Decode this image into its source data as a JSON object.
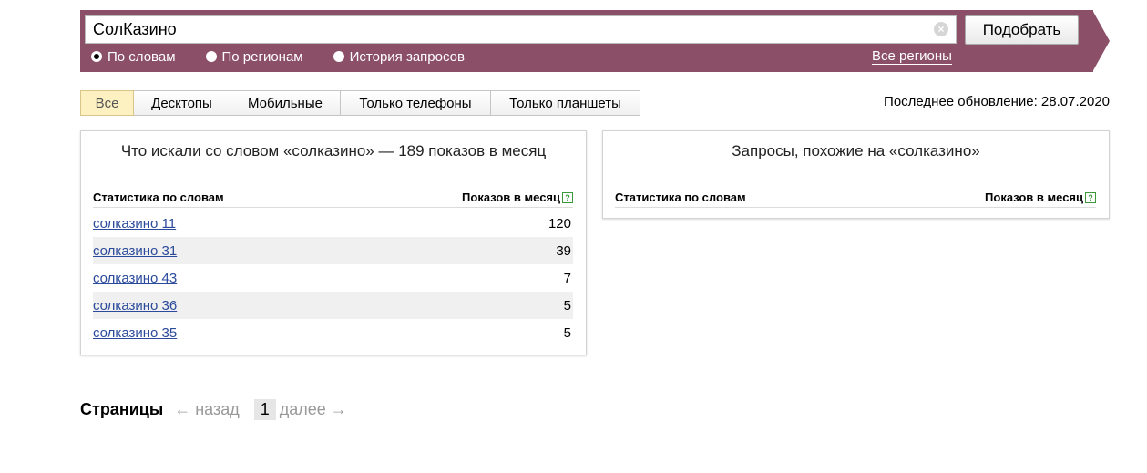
{
  "search": {
    "value": "СолКазино",
    "clear_glyph": "×",
    "submit_label": "Подобрать"
  },
  "modes": [
    {
      "label": "По словам",
      "checked": true
    },
    {
      "label": "По регионам",
      "checked": false
    },
    {
      "label": "История запросов",
      "checked": false
    }
  ],
  "regions_link": "Все регионы",
  "tabs": [
    "Все",
    "Десктопы",
    "Мобильные",
    "Только телефоны",
    "Только планшеты"
  ],
  "active_tab": "Все",
  "updated": "Последнее обновление: 28.07.2020",
  "left_card": {
    "title": "Что искали со словом «солказино» — 189 показов в месяц",
    "col_words": "Статистика по словам",
    "col_shows": "Показов в месяц",
    "help_glyph": "?",
    "rows": [
      {
        "phrase": "солказино 11",
        "shows": "120"
      },
      {
        "phrase": "солказино 31",
        "shows": "39"
      },
      {
        "phrase": "солказино 43",
        "shows": "7"
      },
      {
        "phrase": "солказино 36",
        "shows": "5"
      },
      {
        "phrase": "солказино 35",
        "shows": "5"
      }
    ]
  },
  "right_card": {
    "title": "Запросы, похожие на «солказино»",
    "col_words": "Статистика по словам",
    "col_shows": "Показов в месяц",
    "help_glyph": "?"
  },
  "pager": {
    "label": "Страницы",
    "prev": "← назад",
    "current": "1",
    "next": "далее →"
  },
  "colors": {
    "banner": "#8c4f68",
    "link": "#2b4a9b",
    "active_tab": "#fdf1c2"
  }
}
